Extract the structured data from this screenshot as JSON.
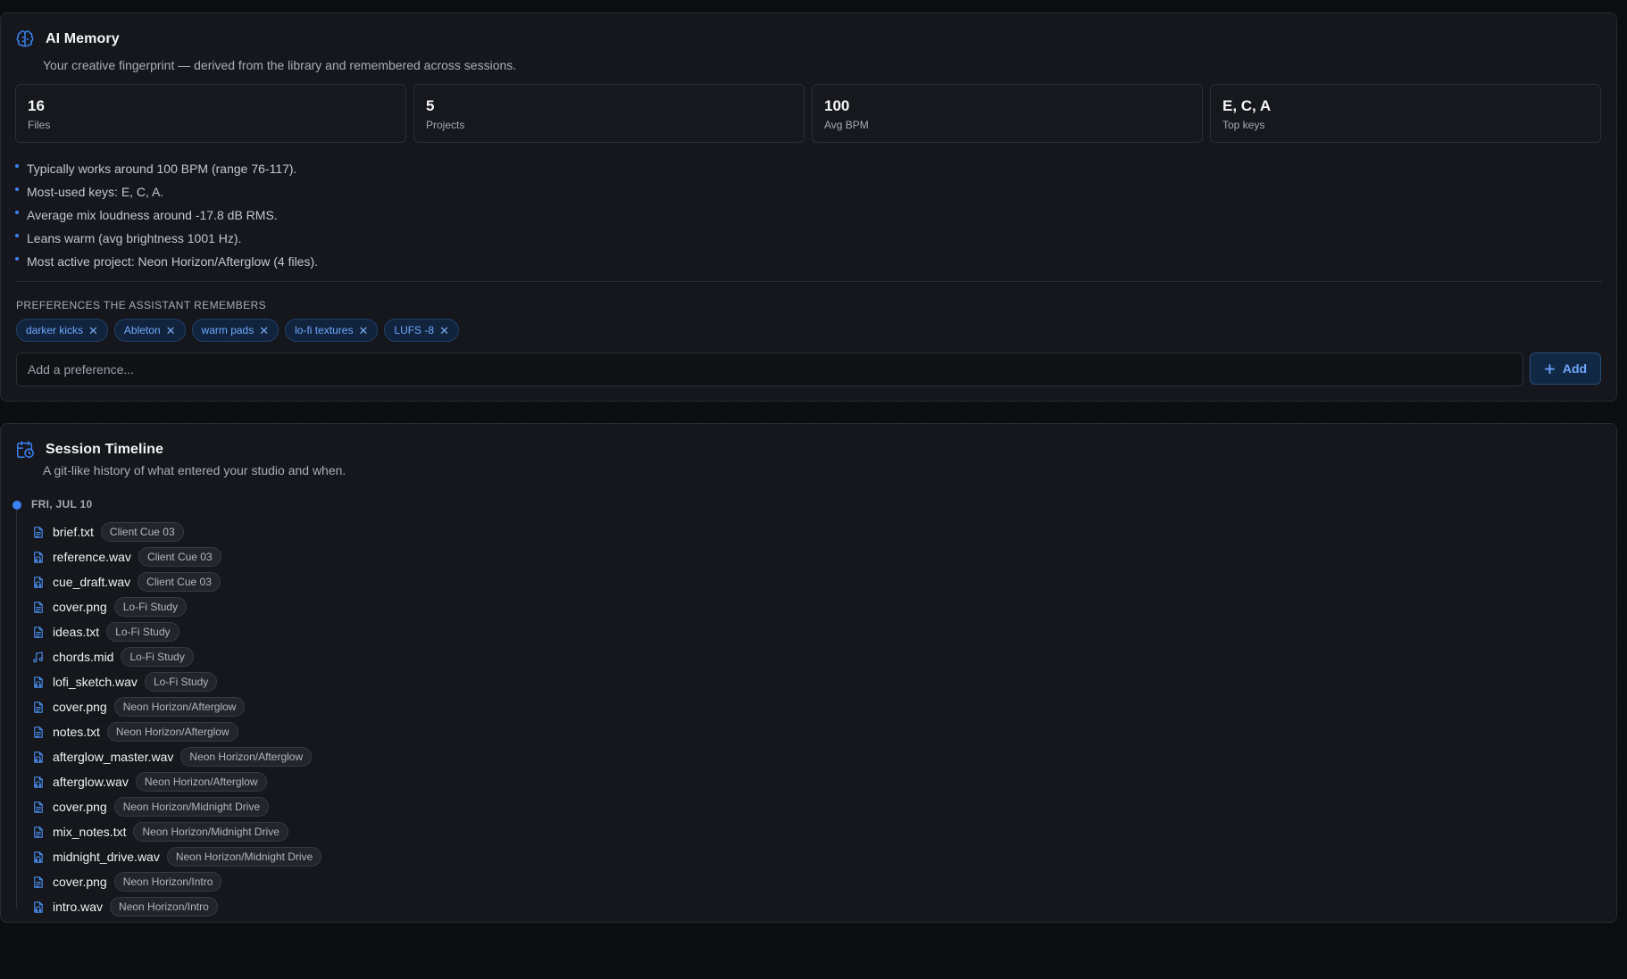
{
  "memory": {
    "title": "AI Memory",
    "subtitle": "Your creative fingerprint — derived from the library and remembered across sessions.",
    "stats": [
      {
        "value": "16",
        "label": "Files"
      },
      {
        "value": "5",
        "label": "Projects"
      },
      {
        "value": "100",
        "label": "Avg BPM"
      },
      {
        "value": "E, C, A",
        "label": "Top keys"
      }
    ],
    "insights": [
      "Typically works around 100 BPM (range 76-117).",
      "Most-used keys: E, C, A.",
      "Average mix loudness around -17.8 dB RMS.",
      "Leans warm (avg brightness 1001 Hz).",
      "Most active project: Neon Horizon/Afterglow (4 files)."
    ],
    "preferences_heading": "PREFERENCES THE ASSISTANT REMEMBERS",
    "preferences": [
      "darker kicks",
      "Ableton",
      "warm pads",
      "lo-fi textures",
      "LUFS -8"
    ],
    "remove_glyph": "✕",
    "input_placeholder": "Add a preference...",
    "add_label": "Add"
  },
  "timeline": {
    "title": "Session Timeline",
    "subtitle": "A git-like history of what entered your studio and when.",
    "date": "FRI, JUL 10",
    "items": [
      {
        "name": "brief.txt",
        "tag": "Client Cue 03",
        "icon": "document-icon"
      },
      {
        "name": "reference.wav",
        "tag": "Client Cue 03",
        "icon": "audio-file-icon"
      },
      {
        "name": "cue_draft.wav",
        "tag": "Client Cue 03",
        "icon": "audio-file-icon"
      },
      {
        "name": "cover.png",
        "tag": "Lo-Fi Study",
        "icon": "document-icon"
      },
      {
        "name": "ideas.txt",
        "tag": "Lo-Fi Study",
        "icon": "document-icon"
      },
      {
        "name": "chords.mid",
        "tag": "Lo-Fi Study",
        "icon": "music-note-icon"
      },
      {
        "name": "lofi_sketch.wav",
        "tag": "Lo-Fi Study",
        "icon": "audio-file-icon"
      },
      {
        "name": "cover.png",
        "tag": "Neon Horizon/Afterglow",
        "icon": "document-icon"
      },
      {
        "name": "notes.txt",
        "tag": "Neon Horizon/Afterglow",
        "icon": "document-icon"
      },
      {
        "name": "afterglow_master.wav",
        "tag": "Neon Horizon/Afterglow",
        "icon": "audio-file-icon"
      },
      {
        "name": "afterglow.wav",
        "tag": "Neon Horizon/Afterglow",
        "icon": "audio-file-icon"
      },
      {
        "name": "cover.png",
        "tag": "Neon Horizon/Midnight Drive",
        "icon": "document-icon"
      },
      {
        "name": "mix_notes.txt",
        "tag": "Neon Horizon/Midnight Drive",
        "icon": "document-icon"
      },
      {
        "name": "midnight_drive.wav",
        "tag": "Neon Horizon/Midnight Drive",
        "icon": "audio-file-icon"
      },
      {
        "name": "cover.png",
        "tag": "Neon Horizon/Intro",
        "icon": "document-icon"
      },
      {
        "name": "intro.wav",
        "tag": "Neon Horizon/Intro",
        "icon": "audio-file-icon"
      }
    ]
  },
  "colors": {
    "accent": "#3b82f6",
    "background": "#0b0d11",
    "card": "#15171c"
  }
}
